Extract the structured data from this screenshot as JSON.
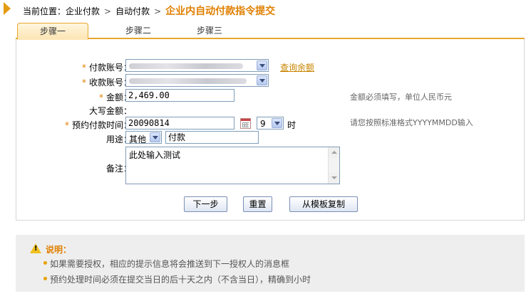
{
  "breadcrumb": {
    "prefix": "当前位置：",
    "items": [
      "企业付款",
      "自动付款"
    ],
    "separator": ">",
    "current": "企业内自动付款指令提交"
  },
  "tabs": [
    {
      "label": "步骤一",
      "active": true
    },
    {
      "label": "步骤二",
      "active": false
    },
    {
      "label": "步骤三",
      "active": false
    }
  ],
  "form": {
    "payer_account_label": "付款账号：",
    "payee_account_label": "收款账号：",
    "check_balance_link": "查询余额",
    "amount_label": "金额：",
    "amount_value": "2,469.00",
    "amount_hint": "金额必须填写，单位人民币元",
    "amount_upper_label": "大写金额：",
    "schedule_label": "预约付款时间：",
    "schedule_date": "20090814",
    "schedule_hour": "9",
    "hour_unit": "时",
    "schedule_hint": "请您按照标准格式YYYYMMDD输入",
    "purpose_label": "用途：",
    "purpose_select": "其他",
    "purpose_text": "付款",
    "remark_label": "备注：",
    "remark_value": "此处输入测试"
  },
  "buttons": {
    "next": "下一步",
    "reset": "重置",
    "copy_template": "从模板复制"
  },
  "note": {
    "title": "说明：",
    "items": [
      "如果需要授权，相应的提示信息将会推送到下一授权人的消息框",
      "预约处理时间必须在提交当日的后十天之内（不含当日），精确到小时"
    ]
  },
  "colors": {
    "accent": "#e07f00",
    "tab_border": "#e7a72f",
    "note_bg": "#eeeeee"
  }
}
